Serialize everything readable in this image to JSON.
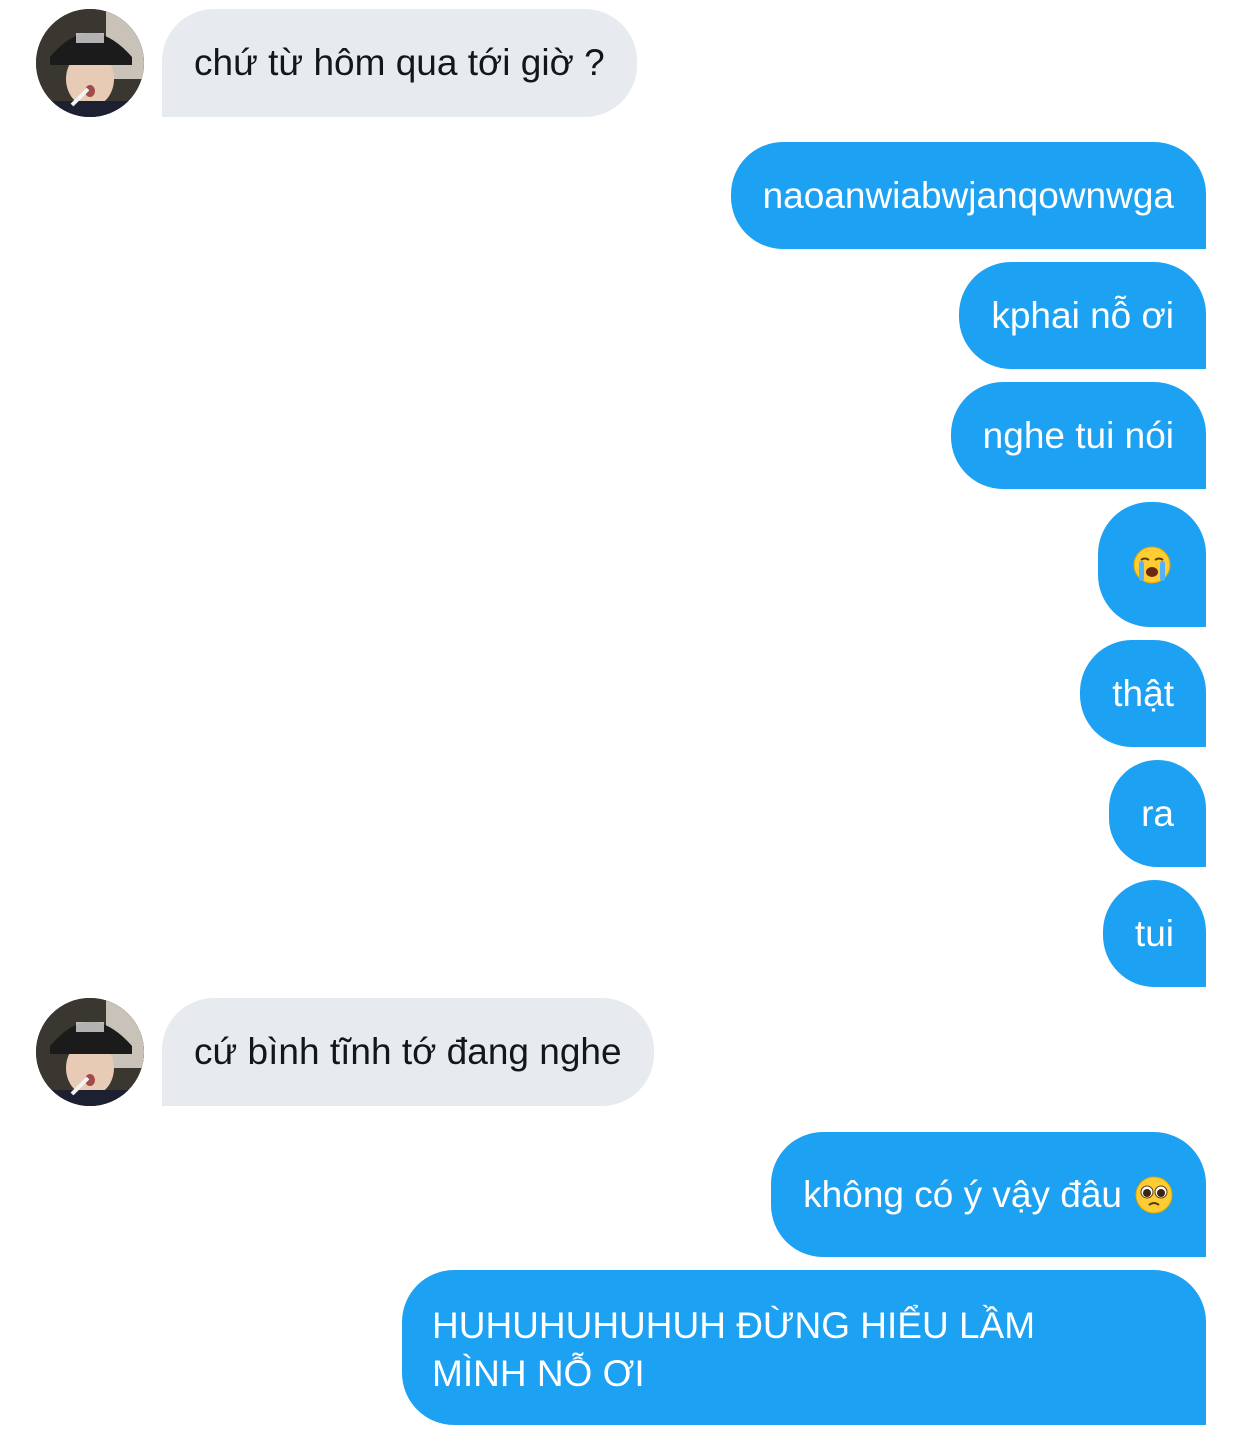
{
  "colors": {
    "incoming_bubble": "#e7ebef",
    "incoming_text": "#14171a",
    "outgoing_bubble": "#1da1f2",
    "outgoing_text": "#ffffff",
    "background": "#ffffff"
  },
  "messages": [
    {
      "direction": "incoming",
      "text": "chứ từ hôm qua tới giờ ?"
    },
    {
      "direction": "outgoing",
      "text": "naoanwiabwjanqownwga"
    },
    {
      "direction": "outgoing",
      "text": "kphai nỗ ơi"
    },
    {
      "direction": "outgoing",
      "text": "nghe tui nói"
    },
    {
      "direction": "outgoing",
      "text": "",
      "icon": "loudly-crying-face-icon"
    },
    {
      "direction": "outgoing",
      "text": "thật"
    },
    {
      "direction": "outgoing",
      "text": "ra"
    },
    {
      "direction": "outgoing",
      "text": "tui"
    },
    {
      "direction": "incoming",
      "text": "cứ bình tĩnh tớ đang nghe"
    },
    {
      "direction": "outgoing",
      "text": "không có ý vậy đâu",
      "icon": "pleading-face-icon"
    },
    {
      "direction": "outgoing",
      "text": "HUHUHUHUHUH ĐỪNG HIỂU LẦM MÌNH NỖ ƠI"
    }
  ]
}
